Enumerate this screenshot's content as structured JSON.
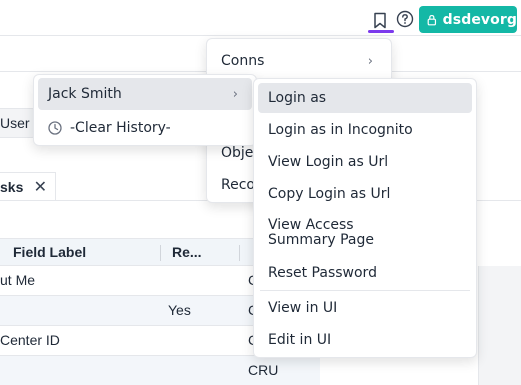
{
  "header": {
    "user_button_label": "dsdevorg"
  },
  "background": {
    "user_tab_fragment": "User T",
    "tasks_tab_fragment": "sks",
    "table": {
      "headers": [
        "Field Label",
        "Re..."
      ],
      "rows": [
        {
          "label": "ut Me",
          "req": "",
          "access": "C"
        },
        {
          "label": "",
          "req": "Yes",
          "access": "C"
        },
        {
          "label": "Center ID",
          "req": "",
          "access": "C"
        },
        {
          "label": "",
          "req": "",
          "access": "CRU"
        }
      ]
    }
  },
  "menus": {
    "middle": {
      "items": [
        {
          "label": "Conns"
        },
        {
          "label": "Obje"
        },
        {
          "label": "Reco"
        }
      ]
    },
    "left": {
      "items": [
        {
          "label": "Jack Smith"
        },
        {
          "label": "-Clear History-"
        }
      ]
    },
    "right": {
      "items": [
        {
          "label": "Login as"
        },
        {
          "label": "Login as in Incognito"
        },
        {
          "label": "View Login as Url"
        },
        {
          "label": "Copy Login as Url"
        },
        {
          "label": "View Access Summary Page"
        },
        {
          "label": "Reset Password"
        },
        {
          "label": "View in UI"
        },
        {
          "label": "Edit in UI"
        }
      ]
    }
  },
  "colors": {
    "accent_teal": "#14b8a6",
    "active_tab_purple": "#7c3aed"
  }
}
